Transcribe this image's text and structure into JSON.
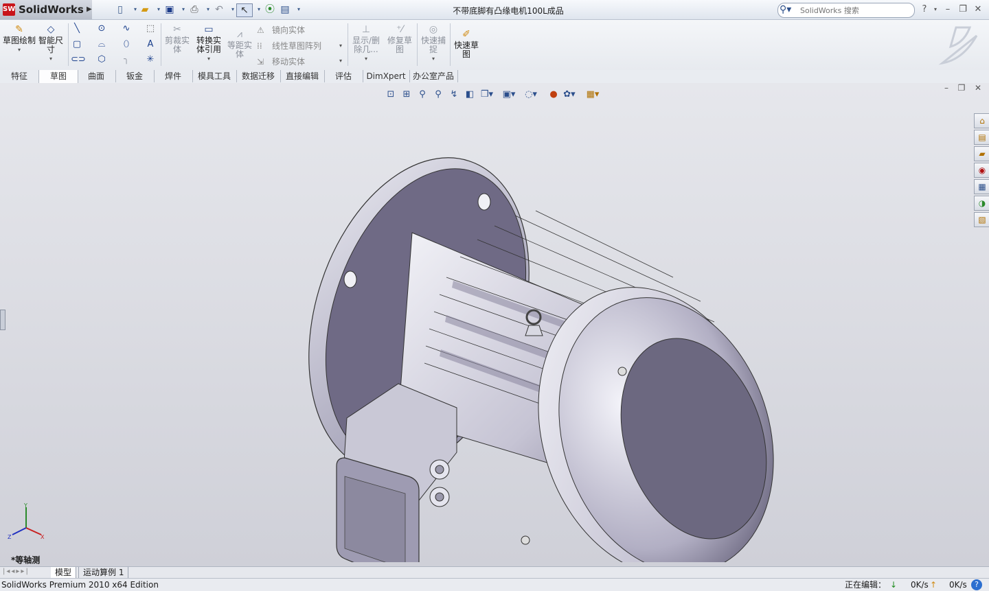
{
  "app": {
    "name": "SolidWorks",
    "document_title": "不带底脚有凸缘电机100L成品"
  },
  "search": {
    "placeholder": "SolidWorks 搜索"
  },
  "ribbon": {
    "sketch": "草图绘制",
    "smart_dim": "智能尺寸",
    "trim": "剪裁实体",
    "convert": "转换实体引用",
    "offset": "等距实体",
    "mirror": "镜向实体",
    "linear_pattern": "线性草图阵列",
    "move": "移动实体",
    "show_delete": "显示/删除几...",
    "repair": "修复草图",
    "quick_snap": "快速捕捉",
    "rapid_sketch": "快速草图"
  },
  "tabs": [
    "特征",
    "草图",
    "曲面",
    "钣金",
    "焊件",
    "模具工具",
    "数据迁移",
    "直接编辑",
    "评估",
    "DimXpert",
    "办公室产品"
  ],
  "active_tab": "草图",
  "view": {
    "orientation_label": "*等轴测"
  },
  "bottom_tabs": [
    "模型",
    "运动算例 1"
  ],
  "status": {
    "edition": "SolidWorks Premium 2010 x64 Edition",
    "editing": "正在编辑：",
    "download": "0K/s",
    "upload": "0K/s"
  },
  "colors": {
    "viewport_bg": "#d8d9e0",
    "motor_body": "#cfd0dc",
    "motor_dark": "#6c6880",
    "accent": "#c8141a"
  }
}
